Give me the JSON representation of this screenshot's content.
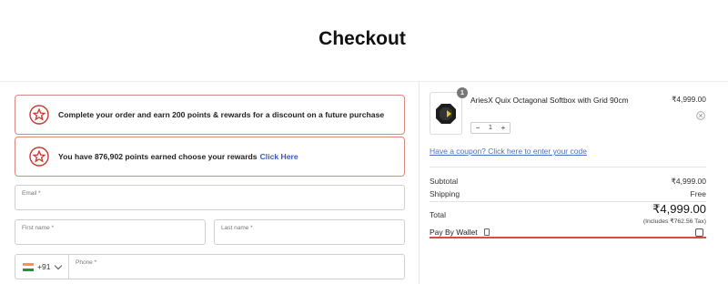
{
  "page": {
    "title": "Checkout"
  },
  "rewards": {
    "banner1_text": "Complete your order and earn 200 points & rewards for a discount on a future purchase",
    "banner2_text": "You have 876,902 points earned choose your rewards",
    "banner2_link": "Click Here",
    "icon": "star-badge-icon",
    "border_color": "#d9887f",
    "accent": "#c8392f"
  },
  "form": {
    "email_label": "Email *",
    "first_name_label": "First name *",
    "last_name_label": "Last name *",
    "phone_label": "Phone *",
    "country_code": "+91",
    "country_flag": "india-flag-icon"
  },
  "cart": {
    "items": [
      {
        "quantity_badge": "1",
        "name": "AriesX Quix Octagonal Softbox with Grid 90cm",
        "price": "₹4,999.00",
        "quantity": "1",
        "decrease": "−",
        "increase": "+"
      }
    ],
    "coupon_text": "Have a coupon? Click here to enter your code",
    "subtotal_label": "Subtotal",
    "subtotal_value": "₹4,999.00",
    "shipping_label": "Shipping",
    "shipping_value": "Free",
    "total_label": "Total",
    "total_value": "₹4,999.00",
    "tax_note": "(Includes ₹762.56 Tax)",
    "wallet_label": "Pay By Wallet",
    "wallet_checked": false,
    "link_color": "#4a6fc4",
    "highlight_color": "#d94b45"
  }
}
